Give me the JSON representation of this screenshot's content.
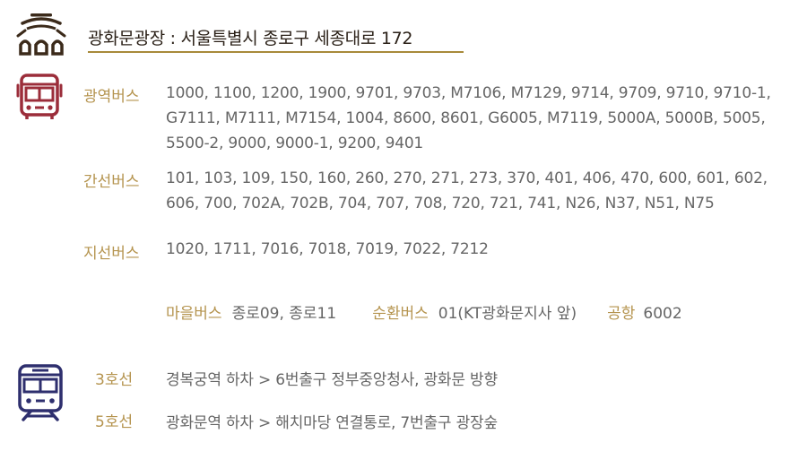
{
  "location": {
    "title": "광화문광장 : 서울특별시 종로구 세종대로 172",
    "icon": "palace-gate-icon"
  },
  "bus": {
    "icon": "bus-icon",
    "wide_area": {
      "label": "광역버스",
      "routes": "1000, 1100, 1200, 1900, 9701, 9703, M7106, M7129, 9714, 9709, 9710, 9710-1, G7111, M7111, M7154, 1004, 8600, 8601, G6005, M7119, 5000A, 5000B, 5005, 5500-2, 9000, 9000-1, 9200, 9401"
    },
    "trunk": {
      "label": "간선버스",
      "routes": "101, 103, 109, 150, 160, 260, 270, 271, 273, 370, 401, 406, 470, 600, 601, 602, 606, 700, 702A, 702B, 704, 707, 708, 720, 721, 741, N26, N37, N51, N75"
    },
    "branch": {
      "label": "지선버스",
      "routes": "1020, 1711, 7016, 7018, 7019, 7022, 7212"
    },
    "village": {
      "label": "마을버스",
      "routes": "종로09, 종로11"
    },
    "circular": {
      "label": "순환버스",
      "routes": "01(KT광화문지사 앞)"
    },
    "airport": {
      "label": "공항",
      "routes": "6002"
    }
  },
  "subway": {
    "icon": "subway-train-icon",
    "lines": [
      {
        "line": "3호선",
        "desc": "경복궁역 하차 > 6번출구 정부중앙청사, 광화문 방향"
      },
      {
        "line": "5호선",
        "desc": "광화문역 하차 > 해치마당 연결통로, 7번출구 광장숲"
      }
    ]
  },
  "colors": {
    "accent": "#b5944f",
    "bus_icon": "#9b2d3a",
    "subway_icon": "#2e2f6e",
    "gate_icon": "#3b2a1a",
    "text": "#666666"
  }
}
